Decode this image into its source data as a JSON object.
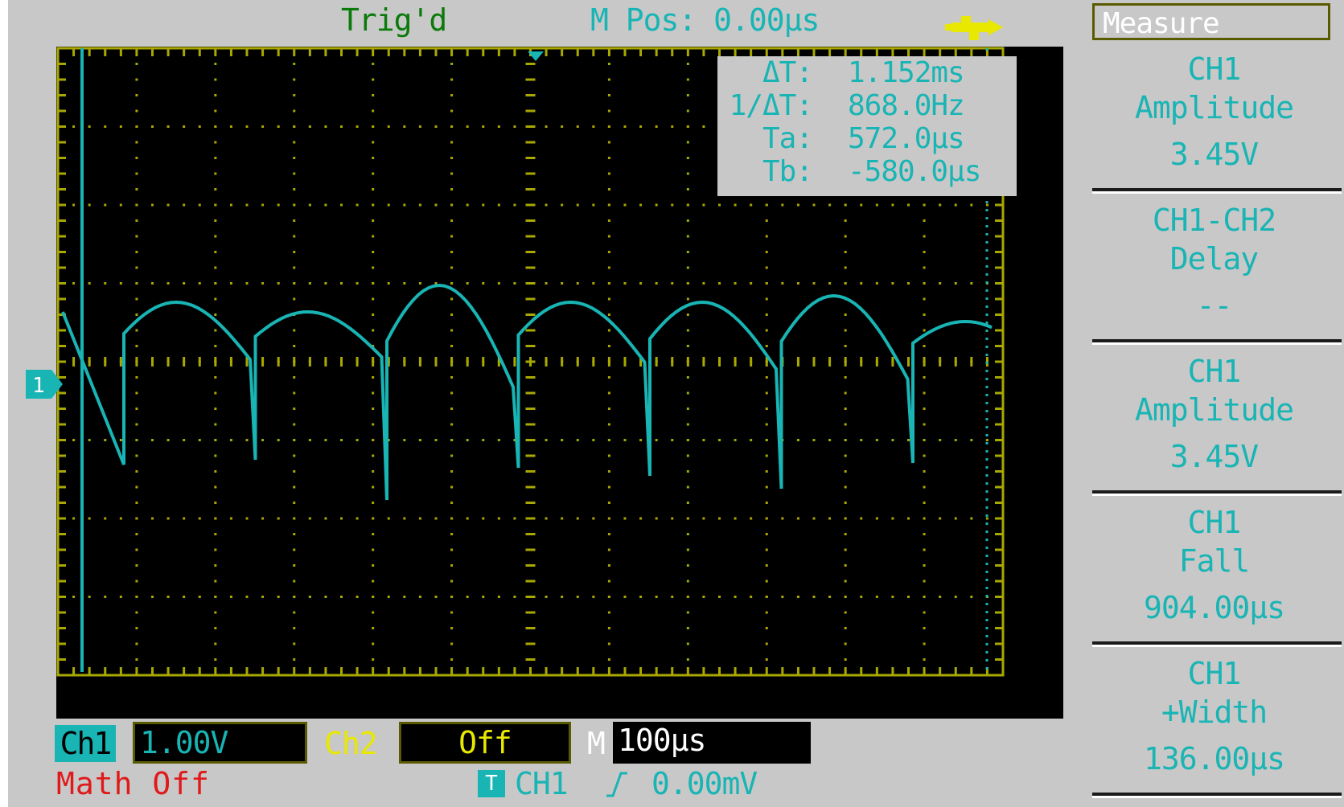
{
  "header": {
    "trigger_status": "Trig'd",
    "main_position": "M Pos: 0.00µs",
    "usb_icon": "usb-icon"
  },
  "cursor_readout": {
    "rows": [
      {
        "label": "ΔT:",
        "value": "1.152ms"
      },
      {
        "label": "1/ΔT:",
        "value": "868.0Hz"
      },
      {
        "label": "Ta:",
        "value": "572.0µs"
      },
      {
        "label": "Tb:",
        "value": "-580.0µs"
      }
    ]
  },
  "menu": {
    "title": "Measure",
    "items": [
      {
        "source": "CH1",
        "type": "Amplitude",
        "value": "3.45V"
      },
      {
        "source": "CH1-CH2",
        "type": "Delay",
        "value": "--"
      },
      {
        "source": "CH1",
        "type": "Amplitude",
        "value": "3.45V"
      },
      {
        "source": "CH1",
        "type": "Fall",
        "value": "904.00µs"
      },
      {
        "source": "CH1",
        "type": "+Width",
        "value": "136.00µs"
      }
    ]
  },
  "status_bar": {
    "ch1_label": "Ch1",
    "ch1_scale": "1.00V",
    "ch2_label": "Ch2",
    "ch2_state": "Off",
    "timebase_label": "M",
    "timebase": "100µs",
    "math_state": "Math Off",
    "trigger_marker": "T",
    "trigger_source": "CH1",
    "trigger_level": "0.00mV"
  },
  "channel_marker": "1",
  "colors": {
    "ch1": "#19b4b4",
    "ch2": "#e8e800",
    "graticule": "#a8a800",
    "math": "#e01a1a",
    "trigger_status": "#0a7a0a"
  },
  "waveform": {
    "channel": "CH1",
    "shape": "full-wave rectified sine",
    "peaks_visible": 7
  }
}
